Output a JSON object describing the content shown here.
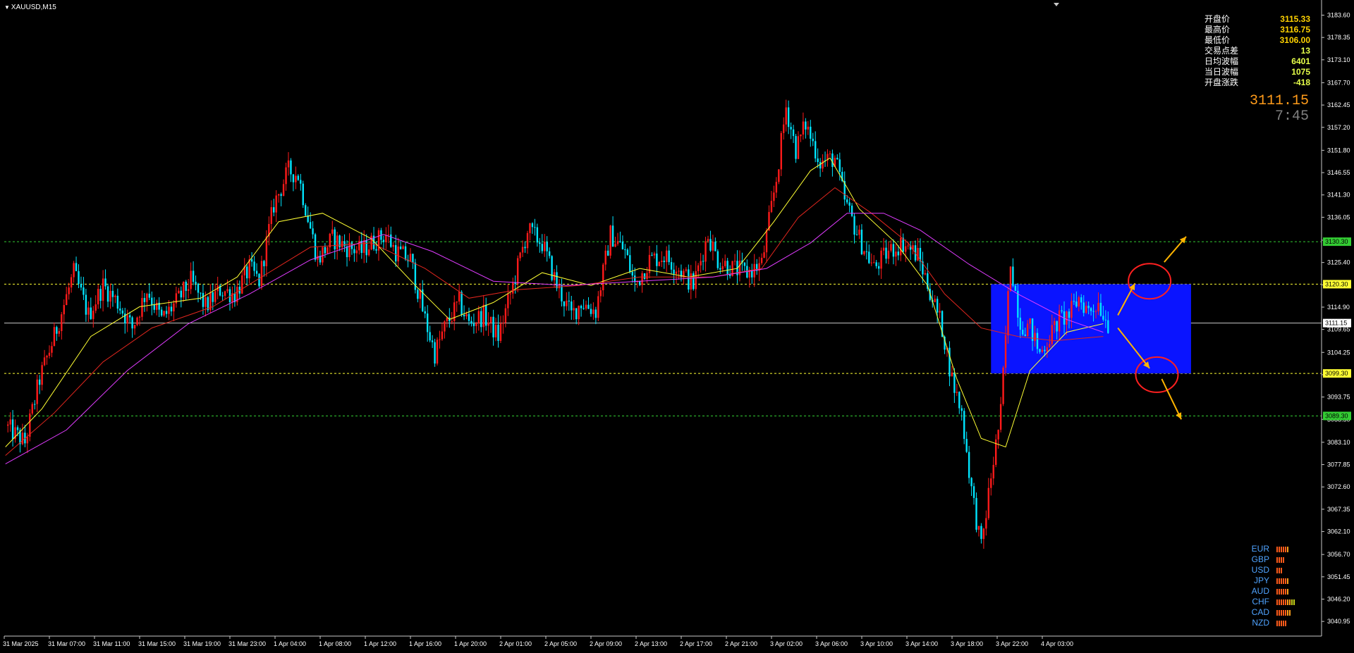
{
  "symbol": "XAUUSD,M15",
  "colors": {
    "bull": "#ff1a1a",
    "bear": "#00e5ff",
    "ma_fast": "#ffff33",
    "ma_mid": "#e0261e",
    "ma_slow": "#e03cff",
    "box": "#0a14ff",
    "arrow": "#ffb400",
    "circle": "#ff2020",
    "level_green": "#33cc33",
    "level_yellow": "#ffff33"
  },
  "info_panel": [
    {
      "label": "开盘价",
      "value": "3115.33"
    },
    {
      "label": "最高价",
      "value": "3116.75"
    },
    {
      "label": "最低价",
      "value": "3106.00"
    },
    {
      "label": "交易点差",
      "value": "13"
    },
    {
      "label": "日均波幅",
      "value": "6401"
    },
    {
      "label": "当日波幅",
      "value": "1075"
    },
    {
      "label": "开盘涨跌",
      "value": "-418"
    }
  ],
  "current_price": "3111.15",
  "countdown": "7:45",
  "currency_strength": [
    {
      "name": "EUR",
      "level": 6
    },
    {
      "name": "GBP",
      "level": 4
    },
    {
      "name": "USD",
      "level": 3
    },
    {
      "name": "JPY",
      "level": 6
    },
    {
      "name": "AUD",
      "level": 6
    },
    {
      "name": "CHF",
      "level": 9
    },
    {
      "name": "CAD",
      "level": 7
    },
    {
      "name": "NZD",
      "level": 5
    }
  ],
  "chart_data": {
    "type": "candlestick",
    "ylim": [
      3037.5,
      3186.5
    ],
    "y_ticks": [
      "3183.60",
      "3178.35",
      "3173.10",
      "3167.70",
      "3162.45",
      "3157.20",
      "3151.80",
      "3146.55",
      "3141.30",
      "3136.05",
      "3130.65",
      "3125.40",
      "3120.15",
      "3114.90",
      "3109.65",
      "3104.25",
      "3099.00",
      "3093.75",
      "3088.50",
      "3083.10",
      "3077.85",
      "3072.60",
      "3067.35",
      "3062.10",
      "3056.70",
      "3051.45",
      "3046.20",
      "3040.95"
    ],
    "x_ticks": [
      "31 Mar 2025",
      "31 Mar 07:00",
      "31 Mar 11:00",
      "31 Mar 15:00",
      "31 Mar 19:00",
      "31 Mar 23:00",
      "1 Apr 04:00",
      "1 Apr 08:00",
      "1 Apr 12:00",
      "1 Apr 16:00",
      "1 Apr 20:00",
      "2 Apr 01:00",
      "2 Apr 05:00",
      "2 Apr 09:00",
      "2 Apr 13:00",
      "2 Apr 17:00",
      "2 Apr 21:00",
      "3 Apr 02:00",
      "3 Apr 06:00",
      "3 Apr 10:00",
      "3 Apr 14:00",
      "3 Apr 18:00",
      "3 Apr 22:00",
      "4 Apr 03:00"
    ],
    "price_path": [
      [
        0,
        3087
      ],
      [
        8,
        3083
      ],
      [
        14,
        3098
      ],
      [
        20,
        3108
      ],
      [
        28,
        3123
      ],
      [
        34,
        3113
      ],
      [
        40,
        3120
      ],
      [
        46,
        3116
      ],
      [
        52,
        3110
      ],
      [
        58,
        3119
      ],
      [
        64,
        3112
      ],
      [
        70,
        3116
      ],
      [
        76,
        3121
      ],
      [
        82,
        3115
      ],
      [
        88,
        3119
      ],
      [
        94,
        3118
      ],
      [
        100,
        3124
      ],
      [
        104,
        3121
      ],
      [
        110,
        3139
      ],
      [
        116,
        3147
      ],
      [
        120,
        3146
      ],
      [
        128,
        3126
      ],
      [
        134,
        3131
      ],
      [
        140,
        3129
      ],
      [
        146,
        3128
      ],
      [
        150,
        3130
      ],
      [
        156,
        3132
      ],
      [
        160,
        3128
      ],
      [
        166,
        3126
      ],
      [
        172,
        3112
      ],
      [
        176,
        3104
      ],
      [
        180,
        3110
      ],
      [
        186,
        3116
      ],
      [
        190,
        3111
      ],
      [
        196,
        3113
      ],
      [
        202,
        3108
      ],
      [
        208,
        3120
      ],
      [
        214,
        3133
      ],
      [
        220,
        3130
      ],
      [
        226,
        3120
      ],
      [
        232,
        3113
      ],
      [
        236,
        3116
      ],
      [
        242,
        3114
      ],
      [
        248,
        3132
      ],
      [
        254,
        3128
      ],
      [
        258,
        3120
      ],
      [
        264,
        3126
      ],
      [
        270,
        3127
      ],
      [
        276,
        3124
      ],
      [
        282,
        3120
      ],
      [
        288,
        3132
      ],
      [
        292,
        3126
      ],
      [
        298,
        3124
      ],
      [
        304,
        3123
      ],
      [
        310,
        3125
      ],
      [
        316,
        3145
      ],
      [
        320,
        3162
      ],
      [
        324,
        3152
      ],
      [
        328,
        3158
      ],
      [
        334,
        3149
      ],
      [
        340,
        3150
      ],
      [
        344,
        3140
      ],
      [
        350,
        3131
      ],
      [
        356,
        3124
      ],
      [
        362,
        3128
      ],
      [
        368,
        3130
      ],
      [
        374,
        3127
      ],
      [
        380,
        3117
      ],
      [
        384,
        3110
      ],
      [
        388,
        3098
      ],
      [
        392,
        3090
      ],
      [
        396,
        3072
      ],
      [
        400,
        3058
      ],
      [
        404,
        3075
      ],
      [
        408,
        3090
      ],
      [
        412,
        3126
      ],
      [
        416,
        3111
      ],
      [
        420,
        3110
      ],
      [
        424,
        3104
      ],
      [
        428,
        3108
      ],
      [
        432,
        3112
      ],
      [
        436,
        3113
      ],
      [
        440,
        3117
      ],
      [
        444,
        3114
      ],
      [
        448,
        3116
      ],
      [
        452,
        3111
      ]
    ],
    "ma_fast": [
      [
        0,
        3082
      ],
      [
        15,
        3091
      ],
      [
        35,
        3108
      ],
      [
        55,
        3115
      ],
      [
        80,
        3117
      ],
      [
        95,
        3122
      ],
      [
        112,
        3135
      ],
      [
        130,
        3137
      ],
      [
        150,
        3131
      ],
      [
        168,
        3120
      ],
      [
        182,
        3112
      ],
      [
        200,
        3116
      ],
      [
        220,
        3123
      ],
      [
        240,
        3120
      ],
      [
        260,
        3124
      ],
      [
        280,
        3122
      ],
      [
        300,
        3124
      ],
      [
        315,
        3135
      ],
      [
        330,
        3147
      ],
      [
        338,
        3150
      ],
      [
        350,
        3138
      ],
      [
        365,
        3130
      ],
      [
        378,
        3120
      ],
      [
        390,
        3098
      ],
      [
        400,
        3084
      ],
      [
        410,
        3082
      ],
      [
        420,
        3100
      ],
      [
        435,
        3109
      ],
      [
        450,
        3111
      ]
    ],
    "ma_mid": [
      [
        0,
        3080
      ],
      [
        20,
        3090
      ],
      [
        40,
        3102
      ],
      [
        60,
        3110
      ],
      [
        85,
        3115
      ],
      [
        105,
        3122
      ],
      [
        125,
        3129
      ],
      [
        150,
        3130
      ],
      [
        172,
        3124
      ],
      [
        190,
        3117
      ],
      [
        210,
        3119
      ],
      [
        235,
        3120
      ],
      [
        260,
        3122
      ],
      [
        290,
        3122
      ],
      [
        310,
        3124
      ],
      [
        325,
        3136
      ],
      [
        340,
        3143
      ],
      [
        355,
        3137
      ],
      [
        370,
        3130
      ],
      [
        385,
        3118
      ],
      [
        400,
        3110
      ],
      [
        415,
        3108
      ],
      [
        430,
        3107
      ],
      [
        450,
        3108
      ]
    ],
    "ma_slow": [
      [
        0,
        3078
      ],
      [
        25,
        3086
      ],
      [
        50,
        3100
      ],
      [
        75,
        3111
      ],
      [
        100,
        3118
      ],
      [
        125,
        3126
      ],
      [
        155,
        3132
      ],
      [
        175,
        3128
      ],
      [
        200,
        3121
      ],
      [
        230,
        3120
      ],
      [
        260,
        3121
      ],
      [
        290,
        3122
      ],
      [
        312,
        3124
      ],
      [
        330,
        3130
      ],
      [
        345,
        3137
      ],
      [
        360,
        3137
      ],
      [
        375,
        3133
      ],
      [
        395,
        3125
      ],
      [
        415,
        3118
      ],
      [
        435,
        3112
      ],
      [
        450,
        3109
      ]
    ],
    "levels": [
      {
        "price": 3130.3,
        "label": "3130.30",
        "color": "#33cc33"
      },
      {
        "price": 3120.3,
        "label": "3120.30",
        "color": "#ffff33"
      },
      {
        "price": 3099.3,
        "label": "3099.30",
        "color": "#ffff33"
      },
      {
        "price": 3089.3,
        "label": "3089.30",
        "color": "#33cc33"
      }
    ],
    "current_level": {
      "price": 3111.15,
      "label": "3111.15"
    },
    "box": {
      "bar_start": 404,
      "bar_end": 486,
      "price_top": 3120.3,
      "price_bottom": 3099.3
    },
    "circles": [
      {
        "bar": 469,
        "price": 3121.0
      },
      {
        "bar": 472,
        "price": 3099.0
      }
    ],
    "arrows": [
      {
        "from": [
          456,
          3113
        ],
        "to": [
          463,
          3120.5
        ]
      },
      {
        "from": [
          475,
          3125.5
        ],
        "to": [
          484,
          3131.5
        ]
      },
      {
        "from": [
          456,
          3110
        ],
        "to": [
          469,
          3100.5
        ]
      },
      {
        "from": [
          474,
          3098
        ],
        "to": [
          482,
          3088.5
        ]
      }
    ]
  }
}
